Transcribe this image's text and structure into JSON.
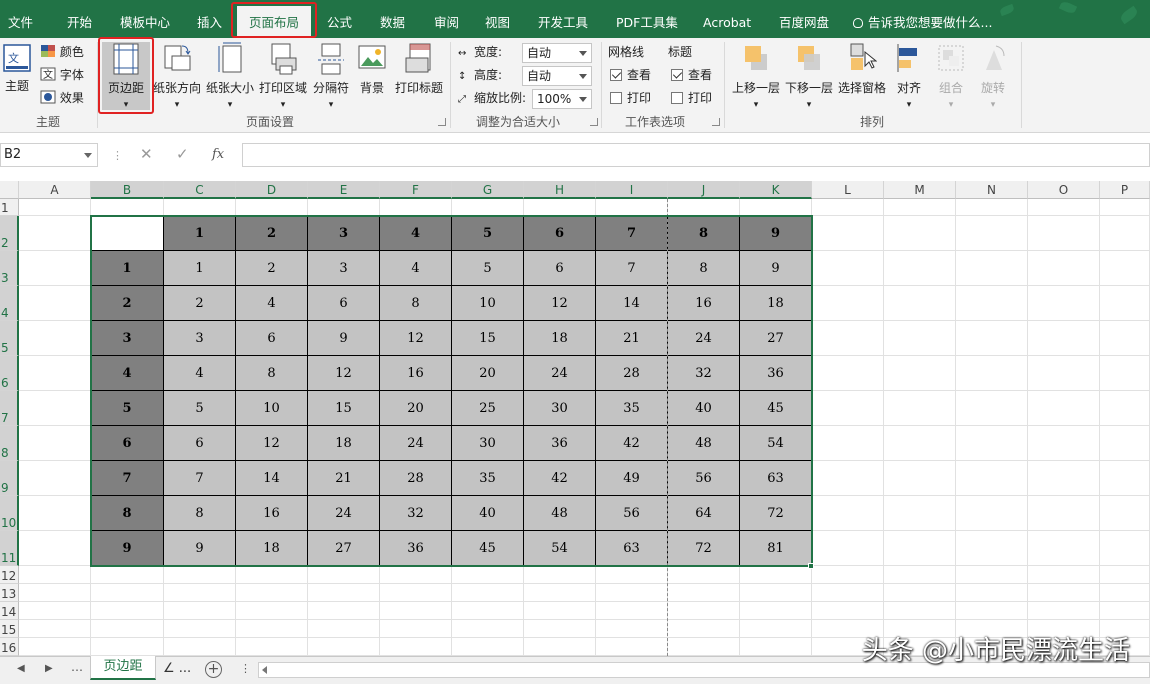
{
  "ribbon_tabs": [
    "文件",
    "开始",
    "模板中心",
    "插入",
    "页面布局",
    "公式",
    "数据",
    "审阅",
    "视图",
    "开发工具",
    "PDF工具集",
    "Acrobat",
    "百度网盘"
  ],
  "active_tab": "页面布局",
  "tell_me": "告诉我您想要做什么...",
  "groups": {
    "theme": {
      "label": "主题",
      "theme_btn": "主题",
      "colors": "颜色",
      "fonts": "字体",
      "effects": "效果"
    },
    "page_setup": {
      "label": "页面设置",
      "margins": "页边距",
      "orientation": "纸张方向",
      "size": "纸张大小",
      "print_area": "打印区域",
      "breaks": "分隔符",
      "background": "背景",
      "print_titles": "打印标题"
    },
    "scale": {
      "label": "调整为合适大小",
      "width_label": "宽度:",
      "width_value": "自动",
      "height_label": "高度:",
      "height_value": "自动",
      "scale_label": "缩放比例:",
      "scale_value": "100%"
    },
    "sheet_options": {
      "label": "工作表选项",
      "gridlines": "网格线",
      "headings": "标题",
      "view": "查看",
      "print": "打印",
      "gridlines_view": true,
      "gridlines_print": false,
      "headings_view": true,
      "headings_print": false
    },
    "arrange": {
      "label": "排列",
      "bring_forward": "上移一层",
      "send_backward": "下移一层",
      "selection_pane": "选择窗格",
      "align": "对齐",
      "group": "组合",
      "rotate": "旋转"
    }
  },
  "name_box": "B2",
  "fx_label": "fx",
  "columns": [
    "A",
    "B",
    "C",
    "D",
    "E",
    "F",
    "G",
    "H",
    "I",
    "J",
    "K",
    "L",
    "M",
    "N",
    "O",
    "P"
  ],
  "rows": [
    "1",
    "2",
    "3",
    "4",
    "5",
    "6",
    "7",
    "8",
    "9",
    "10",
    "11",
    "12",
    "13",
    "14",
    "15",
    "16"
  ],
  "table": {
    "header": [
      "1",
      "2",
      "3",
      "4",
      "5",
      "6",
      "7",
      "8",
      "9"
    ],
    "rows": [
      [
        "1",
        "1",
        "2",
        "3",
        "4",
        "5",
        "6",
        "7",
        "8",
        "9"
      ],
      [
        "2",
        "2",
        "4",
        "6",
        "8",
        "10",
        "12",
        "14",
        "16",
        "18"
      ],
      [
        "3",
        "3",
        "6",
        "9",
        "12",
        "15",
        "18",
        "21",
        "24",
        "27"
      ],
      [
        "4",
        "4",
        "8",
        "12",
        "16",
        "20",
        "24",
        "28",
        "32",
        "36"
      ],
      [
        "5",
        "5",
        "10",
        "15",
        "20",
        "25",
        "30",
        "35",
        "40",
        "45"
      ],
      [
        "6",
        "6",
        "12",
        "18",
        "24",
        "30",
        "36",
        "42",
        "48",
        "54"
      ],
      [
        "7",
        "7",
        "14",
        "21",
        "28",
        "35",
        "42",
        "49",
        "56",
        "63"
      ],
      [
        "8",
        "8",
        "16",
        "24",
        "32",
        "40",
        "48",
        "56",
        "64",
        "72"
      ],
      [
        "9",
        "9",
        "18",
        "27",
        "36",
        "45",
        "54",
        "63",
        "72",
        "81"
      ]
    ]
  },
  "sheet_tab": "页边距",
  "sheet_tab_more": "∠ ...",
  "watermark": "头条 @小市民漂流生活",
  "colors": {
    "accent": "#217346",
    "highlight": "#e02222"
  }
}
